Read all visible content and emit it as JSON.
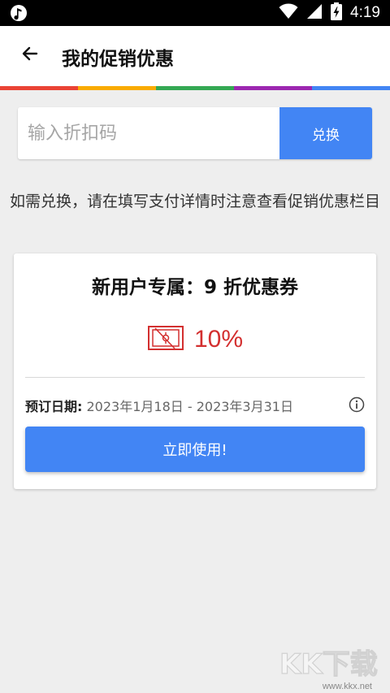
{
  "status_bar": {
    "time": "4:19",
    "left_icon": "music-note-icon",
    "icons": [
      "wifi-icon",
      "signal-icon",
      "battery-icon"
    ],
    "battery_level": "4"
  },
  "header": {
    "back_icon": "arrow-left-icon",
    "title": "我的促销优惠",
    "accent_colors": [
      "#ea4335",
      "#f9ab00",
      "#34a853",
      "#9c27b0",
      "#4285f4"
    ]
  },
  "promo": {
    "placeholder": "输入折扣码",
    "value": "",
    "redeem_label": "兑换",
    "hint": "如需兑换，请在填写支付详情时注意查看促销优惠栏目"
  },
  "coupon": {
    "title": "新用户专属：9 折优惠券",
    "discount_icon": "coupon-ticket-icon",
    "discount_value": "10%",
    "date_label": "预订日期:",
    "date_value": "2023年1月18日 - 2023年3月31日",
    "info_icon": "info-icon",
    "action_label": "立即使用!"
  },
  "colors": {
    "accent_blue": "#4285f4",
    "discount_red": "#d32f2f",
    "background": "#eeeeee"
  },
  "watermark": {
    "text": "KK下载",
    "url": "www.kkx.net"
  }
}
